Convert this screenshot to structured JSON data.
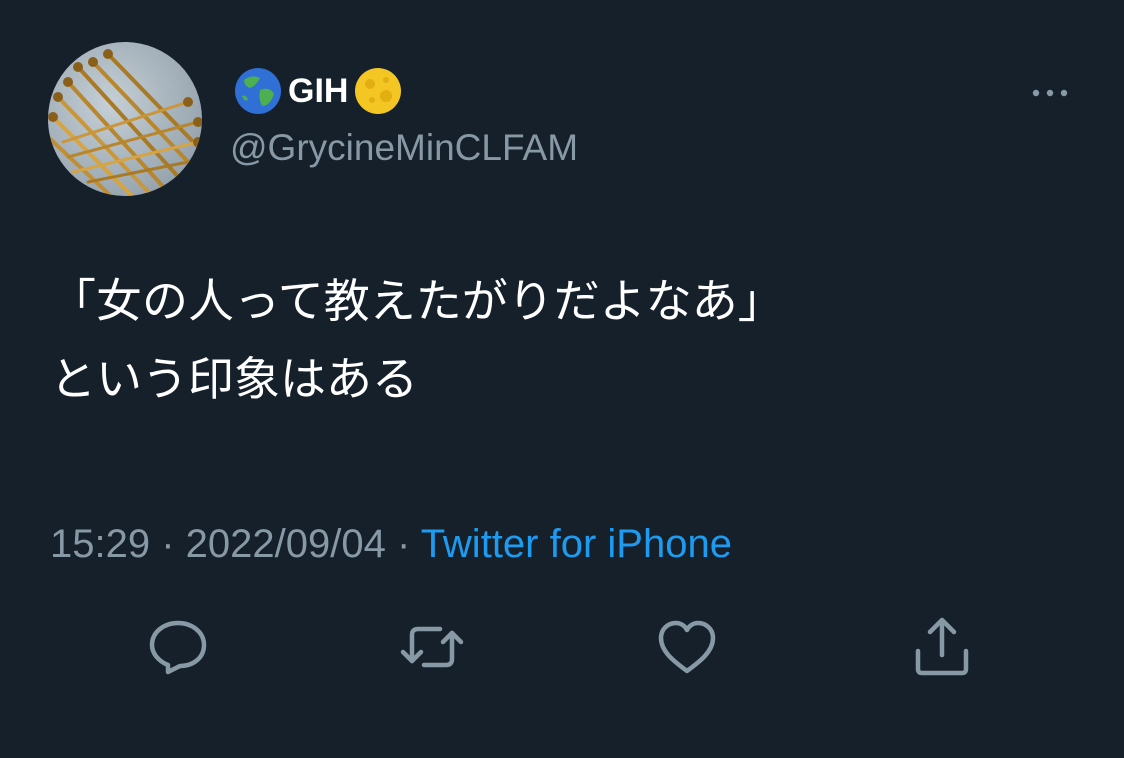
{
  "tweet": {
    "display_name": "GIH",
    "name_emoji_left": "globe-asia-australia-emoji",
    "name_emoji_right": "full-moon-emoji",
    "handle": "@GrycineMinCLFAM",
    "text_lines": [
      "「女の人って教えたがりだよなあ」",
      "という印象はある"
    ],
    "time": "15:29",
    "separator": " · ",
    "date": "2022/09/04",
    "source": "Twitter for iPhone"
  },
  "icons": {
    "more": "more-horizontal-icon",
    "reply": "reply-icon",
    "retweet": "retweet-icon",
    "like": "heart-icon",
    "share": "share-icon"
  },
  "colors": {
    "background": "#15202b",
    "text_primary": "#ffffff",
    "text_secondary": "#8899a6",
    "link": "#1d9bf0"
  }
}
